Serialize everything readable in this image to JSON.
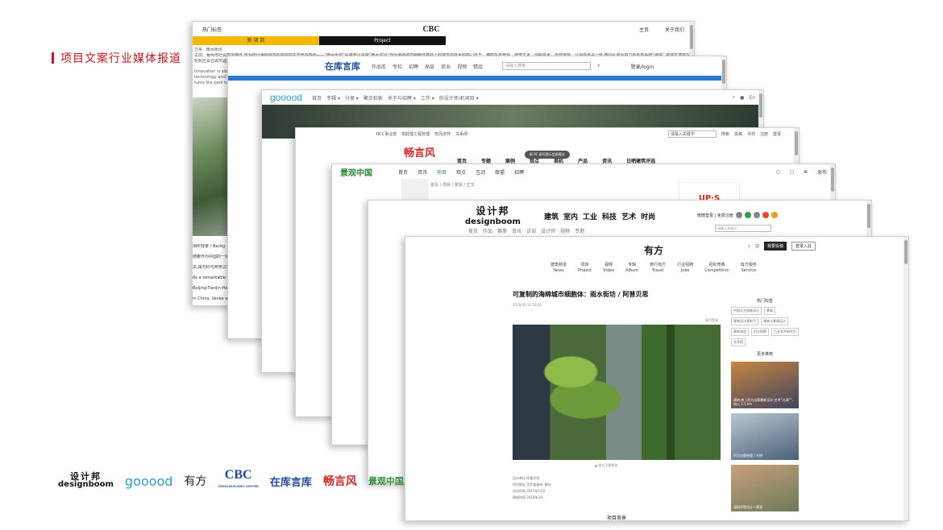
{
  "slide": {
    "title": "项目文案行业媒体报道"
  },
  "w1": {
    "hot": "热门标签:",
    "logo": "CBC",
    "nav1": "主页",
    "nav2": "关于我们",
    "tab_cn": "新 项 目",
    "tab_en": "Project",
    "line1": "方舟 · 雨水街坊",
    "line2": "总前、葡萄地社会集体降低,作为统计海绵城市的高层理生态景观基础——“雨水街坊”是阿普贝思做“雨水花园”作为海绵城市细胞体基础上的理念与技术的核心升华。遵循生态景观、建筑艺术、创新技术、再开放理、让场体最子一体,使园区成为自力的处理系统“弹性”,构成优质的生态示范城市范与",
    "line3": "轮轮应具在城市遇见具",
    "en1": "Innovation is alway",
    "en2": "technology and best",
    "en3": "turns the park to L",
    "bg_title": "场所背景 / Backg",
    "bg_cn": "随着作为中国的一项",
    "bg_cn2": "关,由方科与阿普贝思",
    "bg_en1": "As a remarkable Chi",
    "bg_en2": "Beijing-Tianjin-Heb",
    "bg_en3": "in China, Vanke and"
  },
  "w2": {
    "logo": "在库言库",
    "nav": [
      "作品库",
      "专栏",
      "招聘",
      "高层",
      "商业",
      "视频",
      "精品"
    ],
    "search": "请输入搜索",
    "login": "登录/login"
  },
  "w3": {
    "logo": "gooood",
    "nav": [
      "首页",
      "专辑 ▾",
      "分类 ▾",
      "聚合检索",
      "关于与招聘 ▾",
      "工作 ▾",
      "供设计师/机项目 ▾"
    ],
    "lang": "En"
  },
  "w4": {
    "topnav": [
      "RCC事业部",
      "筑起理工程管理",
      "筑风创作",
      "关系网"
    ],
    "search": "请输入关键字",
    "right": [
      "搜索",
      "投稿",
      "寻材",
      "注册",
      "登录"
    ],
    "logo": "畅言风",
    "menu": [
      "首页",
      "专题",
      "案例",
      "观点",
      "商机",
      "产品",
      "资讯",
      "日晒建筑评选"
    ],
    "toast": "新 PC 即可提示信息模式"
  },
  "w5": {
    "logo": "景观中国",
    "nav": [
      "首页",
      "资讯",
      "项目",
      "观点",
      "互动",
      "联盟",
      "招聘"
    ],
    "crumb": "首页 / 项目 / 景观 / 正文",
    "ad": "UP·S",
    "post": "发布"
  },
  "w6": {
    "logo_cn": "设计邦",
    "logo_en": "designboom",
    "cats": [
      "建筑",
      "室内",
      "工业",
      "科技",
      "艺术",
      "时尚"
    ],
    "menu": [
      "首页",
      "作品",
      "赛事",
      "资讯",
      "访谈",
      "设计师",
      "视频",
      "专题"
    ],
    "search": "请输入关键词",
    "sub": "微微登录 | 免费注册"
  },
  "w7": {
    "logo": "有方",
    "btn1": "我要投稿",
    "btn2": "登录入驻",
    "nav": [
      {
        "cn": "建筑频道",
        "en": "News"
      },
      {
        "cn": "项目",
        "en": "Project"
      },
      {
        "cn": "视频",
        "en": "Video"
      },
      {
        "cn": "专辑",
        "en": "Album"
      },
      {
        "cn": "旅行有方",
        "en": "Travel"
      },
      {
        "cn": "行业招聘",
        "en": "Jobs"
      },
      {
        "cn": "招标竞赛",
        "en": "Competition"
      },
      {
        "cn": "有方服务",
        "en": "Service"
      }
    ],
    "title": "可复制的海绵城市细胞体：雨水街坊 / 阿普贝思",
    "meta": "2018-06-11 16:02",
    "more": "网页登录",
    "caption": "▲ 图片卫星航选",
    "specs": [
      "设计单位  阿普贝思",
      "项目地址  河北省涿州, 廊坊",
      "设计时间  2017年12月",
      "建成时间  2018年3月"
    ],
    "project_bg": "项目背景",
    "side_title": "热门标签",
    "tags": [
      "中国北方园林设计",
      "景观",
      "建筑设计规划子",
      "建筑与景观设计",
      "建筑改造",
      "阿方招聘",
      "行业学术研究学",
      "艺术馆"
    ],
    "side_title2": "更多推荐",
    "thumbs": [
      {
        "text": "建筑·南 | 阿方出版最新设计:艺术“光源””, 加入 1.5 km",
        "c1": "#c88540",
        "c2": "#3f4560"
      },
      {
        "text": "阿方出版经理 | 光明",
        "c1": "#b9c8d3",
        "c2": "#4a6076"
      },
      {
        "text": "深圳学院设计一景观",
        "c1": "#c9a07a",
        "c2": "#6b7a5a"
      }
    ]
  },
  "logos": {
    "designboom_cn": "设计邦",
    "designboom_en": "designboom",
    "gooood": "gooood",
    "youfang": "有方",
    "cbc": "CBC",
    "cbc_sub": "CHINA BUILDING CENTRE",
    "zaiku": "在库言库",
    "changyanfeng": "畅言风",
    "jingguan": "景观中国"
  }
}
